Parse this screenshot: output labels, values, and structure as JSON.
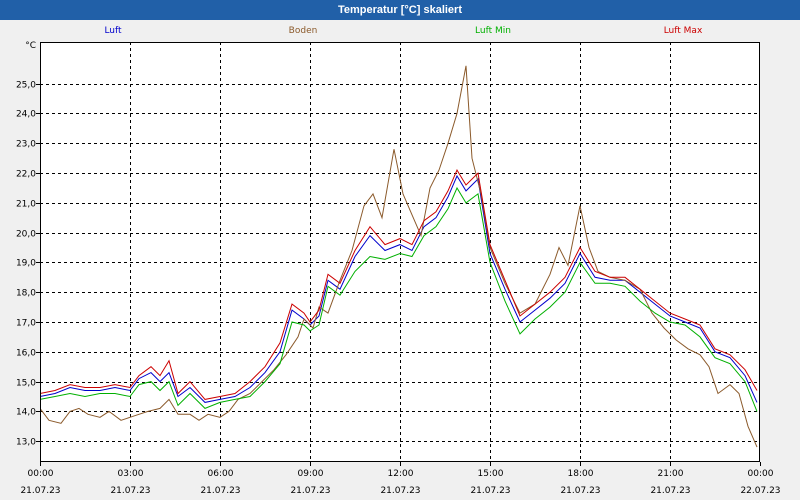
{
  "window": {
    "title": "Temperatur [°C] skaliert"
  },
  "colors": {
    "titlebar": "#2160a8",
    "background": "#f0f0f0",
    "plot_bg": "#ffffff"
  },
  "chart_data": {
    "type": "line",
    "title": "Temperatur [°C] skaliert",
    "ylabel": "°C",
    "xlabel": "",
    "ylim": [
      12.3,
      26.4
    ],
    "xlim": [
      0,
      24
    ],
    "grid": true,
    "legend_position": "top",
    "y_ticks": [
      "25,0",
      "24,0",
      "23,0",
      "22,0",
      "21,0",
      "20,0",
      "19,0",
      "18,0",
      "17,0",
      "16,0",
      "15,0",
      "14,0",
      "13,0"
    ],
    "y_tick_values": [
      25,
      24,
      23,
      22,
      21,
      20,
      19,
      18,
      17,
      16,
      15,
      14,
      13
    ],
    "x_ticks": [
      {
        "time": "00:00",
        "date": "21.07.23",
        "hour": 0
      },
      {
        "time": "03:00",
        "date": "21.07.23",
        "hour": 3
      },
      {
        "time": "06:00",
        "date": "21.07.23",
        "hour": 6
      },
      {
        "time": "09:00",
        "date": "21.07.23",
        "hour": 9
      },
      {
        "time": "12:00",
        "date": "21.07.23",
        "hour": 12
      },
      {
        "time": "15:00",
        "date": "21.07.23",
        "hour": 15
      },
      {
        "time": "18:00",
        "date": "21.07.23",
        "hour": 18
      },
      {
        "time": "21:00",
        "date": "21.07.23",
        "hour": 21
      },
      {
        "time": "00:00",
        "date": "22.07.23",
        "hour": 24
      }
    ],
    "series": [
      {
        "name": "Luft",
        "color": "#0000cc",
        "points": [
          [
            0,
            14.5
          ],
          [
            0.5,
            14.6
          ],
          [
            1,
            14.8
          ],
          [
            1.5,
            14.7
          ],
          [
            2,
            14.7
          ],
          [
            2.5,
            14.8
          ],
          [
            3,
            14.7
          ],
          [
            3.3,
            15.1
          ],
          [
            3.7,
            15.3
          ],
          [
            4,
            15.0
          ],
          [
            4.3,
            15.3
          ],
          [
            4.6,
            14.5
          ],
          [
            5,
            14.8
          ],
          [
            5.5,
            14.3
          ],
          [
            6,
            14.4
          ],
          [
            6.5,
            14.5
          ],
          [
            7,
            14.8
          ],
          [
            7.5,
            15.3
          ],
          [
            8,
            16.0
          ],
          [
            8.4,
            17.4
          ],
          [
            8.8,
            17.1
          ],
          [
            9,
            16.9
          ],
          [
            9.3,
            17.2
          ],
          [
            9.6,
            18.4
          ],
          [
            10,
            18.1
          ],
          [
            10.5,
            19.2
          ],
          [
            11,
            19.9
          ],
          [
            11.5,
            19.4
          ],
          [
            12,
            19.6
          ],
          [
            12.4,
            19.4
          ],
          [
            12.8,
            20.2
          ],
          [
            13.2,
            20.5
          ],
          [
            13.6,
            21.2
          ],
          [
            13.9,
            21.9
          ],
          [
            14.2,
            21.4
          ],
          [
            14.6,
            21.8
          ],
          [
            15,
            19.3
          ],
          [
            15.5,
            18.1
          ],
          [
            16,
            17.0
          ],
          [
            16.5,
            17.4
          ],
          [
            17,
            17.8
          ],
          [
            17.5,
            18.3
          ],
          [
            18,
            19.3
          ],
          [
            18.5,
            18.5
          ],
          [
            19,
            18.4
          ],
          [
            19.5,
            18.4
          ],
          [
            20,
            18.0
          ],
          [
            20.5,
            17.6
          ],
          [
            21,
            17.2
          ],
          [
            21.5,
            17.0
          ],
          [
            22,
            16.8
          ],
          [
            22.5,
            16.0
          ],
          [
            23,
            15.8
          ],
          [
            23.5,
            15.2
          ],
          [
            23.9,
            14.3
          ]
        ]
      },
      {
        "name": "Boden",
        "color": "#8b5a2b",
        "points": [
          [
            0,
            14.1
          ],
          [
            0.3,
            13.7
          ],
          [
            0.7,
            13.6
          ],
          [
            1,
            14.0
          ],
          [
            1.3,
            14.1
          ],
          [
            1.6,
            13.9
          ],
          [
            2,
            13.8
          ],
          [
            2.3,
            14.0
          ],
          [
            2.7,
            13.7
          ],
          [
            3,
            13.8
          ],
          [
            3.3,
            13.9
          ],
          [
            3.6,
            14.0
          ],
          [
            4,
            14.1
          ],
          [
            4.3,
            14.4
          ],
          [
            4.6,
            13.9
          ],
          [
            5,
            13.9
          ],
          [
            5.3,
            13.7
          ],
          [
            5.6,
            13.9
          ],
          [
            6,
            13.8
          ],
          [
            6.3,
            14.0
          ],
          [
            6.6,
            14.4
          ],
          [
            7,
            14.6
          ],
          [
            7.4,
            15.0
          ],
          [
            7.8,
            15.4
          ],
          [
            8.2,
            15.9
          ],
          [
            8.6,
            16.5
          ],
          [
            8.8,
            17.1
          ],
          [
            9.1,
            16.8
          ],
          [
            9.3,
            17.5
          ],
          [
            9.6,
            17.3
          ],
          [
            10,
            18.4
          ],
          [
            10.4,
            19.4
          ],
          [
            10.8,
            20.9
          ],
          [
            11.1,
            21.3
          ],
          [
            11.4,
            20.5
          ],
          [
            11.8,
            22.8
          ],
          [
            12.1,
            21.3
          ],
          [
            12.4,
            20.6
          ],
          [
            12.7,
            19.9
          ],
          [
            13,
            21.5
          ],
          [
            13.3,
            22.1
          ],
          [
            13.6,
            23.0
          ],
          [
            13.9,
            24.0
          ],
          [
            14.2,
            25.6
          ],
          [
            14.4,
            22.5
          ],
          [
            14.7,
            21.3
          ],
          [
            15,
            19.5
          ],
          [
            15.5,
            18.3
          ],
          [
            16,
            17.3
          ],
          [
            16.5,
            17.6
          ],
          [
            17,
            18.6
          ],
          [
            17.3,
            19.5
          ],
          [
            17.6,
            18.9
          ],
          [
            18,
            20.9
          ],
          [
            18.3,
            19.5
          ],
          [
            18.6,
            18.7
          ],
          [
            19,
            18.5
          ],
          [
            19.5,
            18.4
          ],
          [
            20,
            18.1
          ],
          [
            20.4,
            17.3
          ],
          [
            20.8,
            16.8
          ],
          [
            21.2,
            16.4
          ],
          [
            21.6,
            16.1
          ],
          [
            22,
            15.9
          ],
          [
            22.3,
            15.5
          ],
          [
            22.6,
            14.6
          ],
          [
            23,
            14.9
          ],
          [
            23.3,
            14.6
          ],
          [
            23.6,
            13.5
          ],
          [
            23.9,
            12.8
          ]
        ]
      },
      {
        "name": "Luft Min",
        "color": "#00b000",
        "points": [
          [
            0,
            14.4
          ],
          [
            0.5,
            14.5
          ],
          [
            1,
            14.6
          ],
          [
            1.5,
            14.5
          ],
          [
            2,
            14.6
          ],
          [
            2.5,
            14.6
          ],
          [
            3,
            14.5
          ],
          [
            3.3,
            14.9
          ],
          [
            3.7,
            15.0
          ],
          [
            4,
            14.7
          ],
          [
            4.3,
            15.0
          ],
          [
            4.6,
            14.2
          ],
          [
            5,
            14.6
          ],
          [
            5.5,
            14.1
          ],
          [
            6,
            14.3
          ],
          [
            6.5,
            14.4
          ],
          [
            7,
            14.5
          ],
          [
            7.5,
            15.0
          ],
          [
            8,
            15.6
          ],
          [
            8.4,
            17.0
          ],
          [
            8.8,
            16.9
          ],
          [
            9,
            16.7
          ],
          [
            9.3,
            16.9
          ],
          [
            9.6,
            18.2
          ],
          [
            10,
            17.9
          ],
          [
            10.5,
            18.7
          ],
          [
            11,
            19.2
          ],
          [
            11.5,
            19.1
          ],
          [
            12,
            19.3
          ],
          [
            12.4,
            19.2
          ],
          [
            12.8,
            19.9
          ],
          [
            13.2,
            20.2
          ],
          [
            13.6,
            20.8
          ],
          [
            13.9,
            21.5
          ],
          [
            14.2,
            21.0
          ],
          [
            14.6,
            21.3
          ],
          [
            15,
            19.0
          ],
          [
            15.5,
            17.7
          ],
          [
            16,
            16.6
          ],
          [
            16.5,
            17.1
          ],
          [
            17,
            17.5
          ],
          [
            17.5,
            18.0
          ],
          [
            18,
            19.0
          ],
          [
            18.5,
            18.3
          ],
          [
            19,
            18.3
          ],
          [
            19.5,
            18.2
          ],
          [
            20,
            17.7
          ],
          [
            20.5,
            17.3
          ],
          [
            21,
            17.0
          ],
          [
            21.5,
            16.9
          ],
          [
            22,
            16.5
          ],
          [
            22.5,
            15.8
          ],
          [
            23,
            15.6
          ],
          [
            23.5,
            15.0
          ],
          [
            23.9,
            14.0
          ]
        ]
      },
      {
        "name": "Luft Max",
        "color": "#cc0000",
        "points": [
          [
            0,
            14.6
          ],
          [
            0.5,
            14.7
          ],
          [
            1,
            14.9
          ],
          [
            1.5,
            14.8
          ],
          [
            2,
            14.8
          ],
          [
            2.5,
            14.9
          ],
          [
            3,
            14.8
          ],
          [
            3.3,
            15.2
          ],
          [
            3.7,
            15.5
          ],
          [
            4,
            15.2
          ],
          [
            4.3,
            15.7
          ],
          [
            4.6,
            14.6
          ],
          [
            5,
            15.0
          ],
          [
            5.5,
            14.4
          ],
          [
            6,
            14.5
          ],
          [
            6.5,
            14.6
          ],
          [
            7,
            15.0
          ],
          [
            7.5,
            15.5
          ],
          [
            8,
            16.3
          ],
          [
            8.4,
            17.6
          ],
          [
            8.8,
            17.3
          ],
          [
            9,
            17.0
          ],
          [
            9.3,
            17.4
          ],
          [
            9.6,
            18.6
          ],
          [
            10,
            18.3
          ],
          [
            10.5,
            19.4
          ],
          [
            11,
            20.2
          ],
          [
            11.5,
            19.6
          ],
          [
            12,
            19.8
          ],
          [
            12.4,
            19.6
          ],
          [
            12.8,
            20.4
          ],
          [
            13.2,
            20.7
          ],
          [
            13.6,
            21.4
          ],
          [
            13.9,
            22.1
          ],
          [
            14.2,
            21.6
          ],
          [
            14.6,
            22.0
          ],
          [
            15,
            19.6
          ],
          [
            15.5,
            18.4
          ],
          [
            16,
            17.2
          ],
          [
            16.5,
            17.6
          ],
          [
            17,
            18.0
          ],
          [
            17.5,
            18.5
          ],
          [
            18,
            19.5
          ],
          [
            18.5,
            18.7
          ],
          [
            19,
            18.5
          ],
          [
            19.5,
            18.5
          ],
          [
            20,
            18.1
          ],
          [
            20.5,
            17.7
          ],
          [
            21,
            17.3
          ],
          [
            21.5,
            17.1
          ],
          [
            22,
            16.9
          ],
          [
            22.5,
            16.1
          ],
          [
            23,
            15.9
          ],
          [
            23.5,
            15.4
          ],
          [
            23.9,
            14.7
          ]
        ]
      }
    ]
  }
}
